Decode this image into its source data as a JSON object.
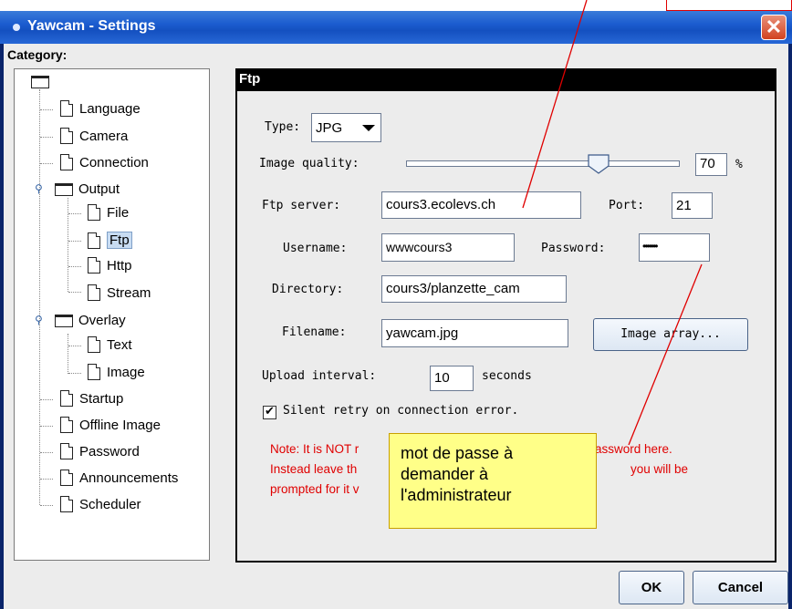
{
  "window": {
    "title": "Yawcam - Settings"
  },
  "category": {
    "label": "Category:",
    "items": [
      {
        "label": "Language",
        "type": "doc"
      },
      {
        "label": "Camera",
        "type": "doc"
      },
      {
        "label": "Connection",
        "type": "doc"
      },
      {
        "label": "Output",
        "type": "folder"
      },
      {
        "label": "File",
        "type": "doc"
      },
      {
        "label": "Ftp",
        "type": "doc",
        "selected": true
      },
      {
        "label": "Http",
        "type": "doc"
      },
      {
        "label": "Stream",
        "type": "doc"
      },
      {
        "label": "Overlay",
        "type": "folder"
      },
      {
        "label": "Text",
        "type": "doc"
      },
      {
        "label": "Image",
        "type": "doc"
      },
      {
        "label": "Startup",
        "type": "doc"
      },
      {
        "label": "Offline Image",
        "type": "doc"
      },
      {
        "label": "Password",
        "type": "doc"
      },
      {
        "label": "Announcements",
        "type": "doc"
      },
      {
        "label": "Scheduler",
        "type": "doc"
      }
    ]
  },
  "ftp": {
    "title": "Ftp",
    "type_label": "Type:",
    "type_value": "JPG",
    "quality_label": "Image quality:",
    "quality_value": "70",
    "quality_unit": "%",
    "server_label": "Ftp server:",
    "server_value": "cours3.ecolevs.ch",
    "port_label": "Port:",
    "port_value": "21",
    "username_label": "Username:",
    "username_value": "wwwcours3",
    "password_label": "Password:",
    "password_value": "•••••••",
    "directory_label": "Directory:",
    "directory_value": "cours3/planzette_cam",
    "filename_label": "Filename:",
    "filename_value": "yawcam.jpg",
    "image_array_button": "Image array...",
    "upload_label": "Upload interval:",
    "upload_value": "10",
    "upload_unit": "seconds",
    "silent_retry_label": "Silent retry on connection error.",
    "note_line1": "Note: It is NOT r",
    "note_line1_end": "assword here.",
    "note_line2": "Instead leave th",
    "note_line2_end": "you will be",
    "note_line3": "prompted for it v"
  },
  "callout": {
    "line1": "mot de passe à",
    "line2": "demander à",
    "line3": "l'administrateur"
  },
  "buttons": {
    "ok": "OK",
    "cancel": "Cancel"
  },
  "colors": {
    "title_bar": "#1b5ccf",
    "annotation_red": "#e00000",
    "callout_yellow": "#ffff88"
  }
}
